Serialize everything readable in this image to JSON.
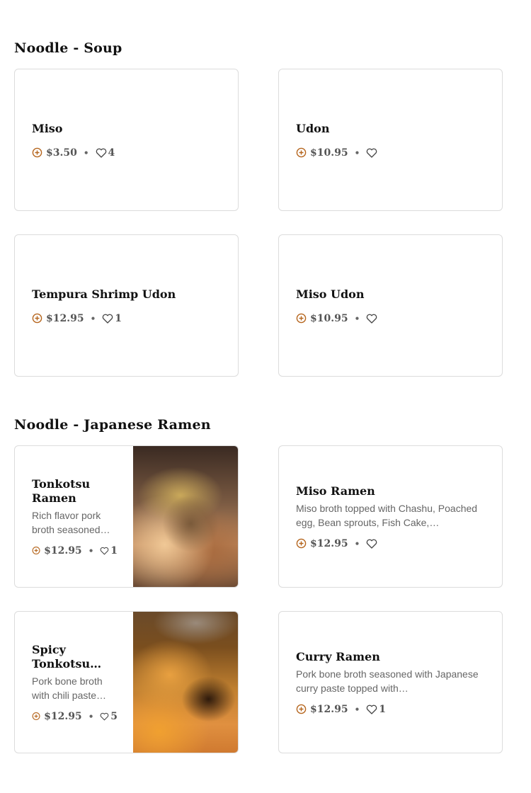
{
  "accent_color": "#b5651d",
  "sections": [
    {
      "title": "Noodle - Soup",
      "items": [
        {
          "name": "Miso",
          "price": "$3.50",
          "likes": "4"
        },
        {
          "name": "Udon",
          "price": "$10.95",
          "likes": ""
        },
        {
          "name": "Tempura Shrimp Udon",
          "price": "$12.95",
          "likes": "1"
        },
        {
          "name": "Miso Udon",
          "price": "$10.95",
          "likes": ""
        }
      ]
    },
    {
      "title": "Noodle - Japanese Ramen",
      "items": [
        {
          "name": "Tonkotsu Ramen",
          "desc": "Rich flavor pork broth seasoned…",
          "price": "$12.95",
          "likes": "1",
          "image": "tonkotsu-ramen-photo"
        },
        {
          "name": "Miso Ramen",
          "desc": "Miso broth topped with Chashu, Poached egg, Bean sprouts, Fish Cake,…",
          "price": "$12.95",
          "likes": ""
        },
        {
          "name": "Spicy Tonkotsu…",
          "desc": "Pork bone broth with chili paste…",
          "price": "$12.95",
          "likes": "5",
          "image": "spicy-tonkotsu-photo"
        },
        {
          "name": "Curry Ramen",
          "desc": "Pork bone broth seasoned with Japanese curry paste topped with…",
          "price": "$12.95",
          "likes": "1"
        }
      ]
    }
  ],
  "icons": {
    "add": "plus-circle-icon",
    "favorite": "heart-icon"
  }
}
